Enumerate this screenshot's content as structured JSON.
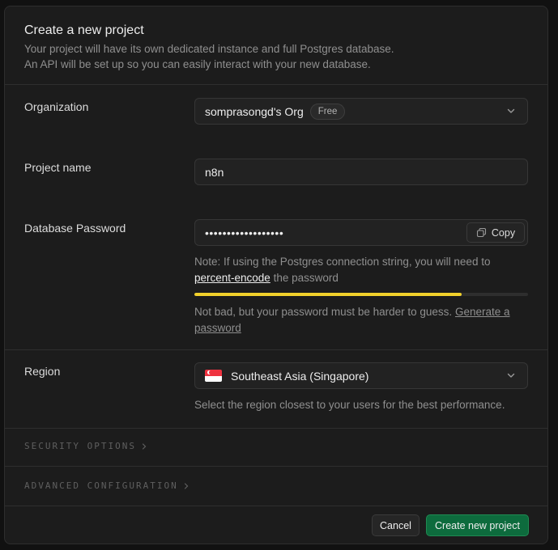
{
  "header": {
    "title": "Create a new project",
    "desc_line1": "Your project will have its own dedicated instance and full Postgres database.",
    "desc_line2": "An API will be set up so you can easily interact with your new database."
  },
  "organization": {
    "label": "Organization",
    "value": "somprasongd's Org",
    "badge": "Free",
    "icon": "chevron-down-icon"
  },
  "project_name": {
    "label": "Project name",
    "value": "n8n"
  },
  "password": {
    "label": "Database Password",
    "masked_value": "••••••••••••••••••",
    "copy_label": "Copy",
    "note_prefix": "Note: If using the Postgres connection string, you will need to",
    "note_link": "percent-encode",
    "note_suffix": "the password",
    "strength_fraction": 0.8,
    "strength_color": "#f1d02b",
    "strength_message": "Not bad, but your password must be harder to guess.",
    "generate_link_1": "Generate a",
    "generate_link_2": "password"
  },
  "region": {
    "label": "Region",
    "value": "Southeast Asia (Singapore)",
    "hint": "Select the region closest to your users for the best performance.",
    "flag": "singapore-flag-icon"
  },
  "sections": {
    "security": "SECURITY OPTIONS",
    "advanced": "ADVANCED CONFIGURATION"
  },
  "footer": {
    "cancel": "Cancel",
    "create": "Create new project"
  },
  "colors": {
    "accent": "#0d6b3d",
    "panel_bg": "#1c1c1c",
    "strength": "#f1d02b"
  }
}
